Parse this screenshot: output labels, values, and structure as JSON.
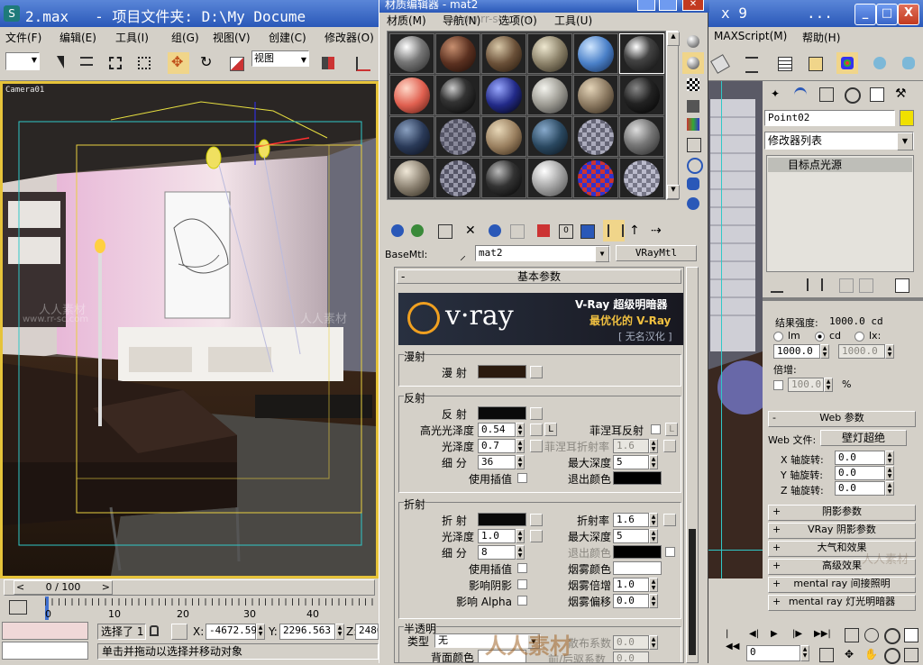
{
  "main_window": {
    "icon_label": "S",
    "title_left": "2.max   - 项目文件夹: D:\\My Docume",
    "title_right": "x 9",
    "title_dots": "...",
    "minimize": "_",
    "maximize": "□",
    "close": "X"
  },
  "menu": [
    "文件(F)",
    "编辑(E)",
    "工具(I)",
    "组(G)",
    "视图(V)",
    "创建(C)",
    "修改器(O)",
    "MAXScript(M)",
    "帮助(H)"
  ],
  "toolbar": {
    "view_select": "视图"
  },
  "viewport": {
    "label": "Camera01"
  },
  "material_editor": {
    "title": "材质编辑器 - mat2",
    "menu": [
      "材质(M)",
      "导航(N)",
      "选项(O)",
      "工具(U)"
    ],
    "basemtl_label": "BaseMtl:",
    "material_name": "mat2",
    "material_type": "VRayMtl",
    "rollout_basic": "基本参数",
    "rollout_minus": "-",
    "vray_brand": "v·ray",
    "vray_line1": "V-Ray 超级明暗器",
    "vray_line2": "最优化的 V-Ray",
    "vray_line3": "[ 无名汉化 ]",
    "diffuse_group": "漫射",
    "diffuse_label": "漫 射",
    "reflection_group": "反射",
    "reflect_label": "反 射",
    "hilight_gloss_label": "高光光泽度",
    "hilight_gloss_value": "0.54",
    "l_button": "L",
    "fresnel_label": "菲涅耳反射",
    "refl_gloss_label": "光泽度",
    "refl_gloss_value": "0.7",
    "fresnel_ior_label": "菲涅耳折射率",
    "fresnel_ior_value": "1.6",
    "refl_subdiv_label": "细 分",
    "refl_subdiv_value": "36",
    "max_depth_label": "最大深度",
    "refl_max_depth": "5",
    "use_interp_label": "使用插值",
    "exit_color_label": "退出颜色",
    "refraction_group": "折射",
    "refract_label": "折 射",
    "ior_label": "折射率",
    "ior_value": "1.6",
    "refr_gloss_label": "光泽度",
    "refr_gloss_value": "1.0",
    "refr_max_depth": "5",
    "refr_subdiv_label": "细 分",
    "refr_subdiv_value": "8",
    "refr_exit_color_label": "退出颜色",
    "refr_use_interp_label": "使用插值",
    "fog_color_label": "烟雾颜色",
    "affect_shadows_label": "影响阴影",
    "fog_mult_label": "烟雾倍增",
    "fog_mult_value": "1.0",
    "affect_alpha_label": "影响 Alpha",
    "fog_bias_label": "烟雾偏移",
    "fog_bias_value": "0.0",
    "translucency_group": "半透明",
    "type_label": "类型",
    "type_value": "无",
    "scatter_label": "散布系数",
    "scatter_value": "0.0",
    "back_color_label": "背面颜色",
    "fwd_back_label": "前/后驱系数",
    "fwd_back_value": "0.0"
  },
  "command_panel": {
    "object_name": "Point02",
    "modifier_list": "修改器列表",
    "stack_item": "目标点光源",
    "intensity_label": "结果强度:",
    "intensity_value": "1000.0 cd",
    "radio_lm": "lm",
    "radio_cd": "cd",
    "radio_lx": "lx:",
    "intensity_input": "1000.0",
    "lx_input": "1000.0",
    "multiplier_label": "倍增:",
    "multiplier_value": "100.0",
    "percent": "%",
    "web_rollout": "Web 参数",
    "web_file_label": "Web 文件:",
    "web_file_value": "壁灯超绝",
    "x_rot_label": "X 轴旋转:",
    "x_rot_value": "0.0",
    "y_rot_label": "Y 轴旋转:",
    "y_rot_value": "0.0",
    "z_rot_label": "Z 轴旋转:",
    "z_rot_value": "0.0",
    "rollouts": [
      "阴影参数",
      "VRay 阴影参数",
      "大气和效果",
      "高级效果",
      "mental ray 间接照明",
      "mental ray 灯光明暗器"
    ]
  },
  "timeline": {
    "frame_label": "0 / 100",
    "ticks": [
      "0",
      "10",
      "20",
      "30",
      "40"
    ]
  },
  "status": {
    "selected": "选择了 1",
    "x_label": "X:",
    "x_value": "-4672.59",
    "y_label": "Y:",
    "y_value": "2296.563",
    "z_label": "Z:",
    "z_value": "2480",
    "prompt": "单击并拖动以选择并移动对象"
  },
  "anim_controls": {
    "frame_value": "0"
  },
  "watermark": {
    "cn": "人人素材",
    "url": "www.rr-sc.com"
  }
}
